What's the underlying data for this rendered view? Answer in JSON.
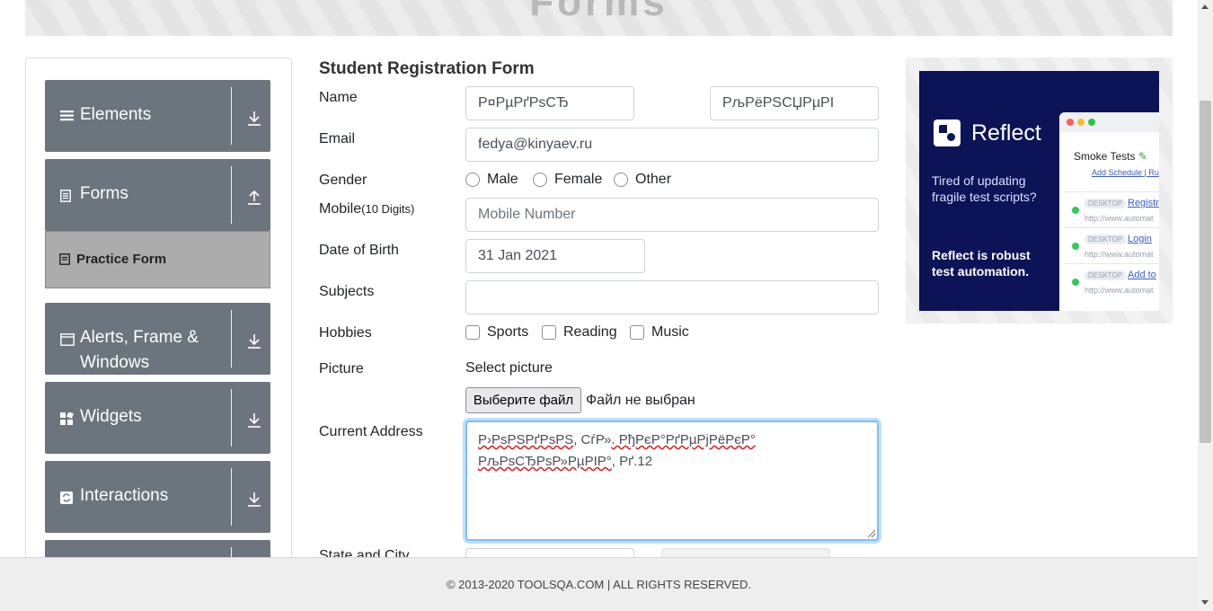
{
  "banner": {
    "title": "Forms"
  },
  "sidebar": {
    "groups": [
      {
        "label": "Elements",
        "icon": "hamburger-icon",
        "arrow": "down"
      },
      {
        "label": "Forms",
        "icon": "document-icon",
        "arrow": "up"
      },
      {
        "label": "Alerts, Frame & Windows",
        "icon": "window-icon",
        "arrow": "down"
      },
      {
        "label": "Widgets",
        "icon": "widgets-icon",
        "arrow": "down"
      },
      {
        "label": "Interactions",
        "icon": "interactions-icon",
        "arrow": "down"
      }
    ],
    "active_item": "Practice Form"
  },
  "form": {
    "title": "Student Registration Form",
    "labels": {
      "name": "Name",
      "email": "Email",
      "gender": "Gender",
      "mobile": "Mobile",
      "mobile_hint": "(10 Digits)",
      "dob": "Date of Birth",
      "subjects": "Subjects",
      "hobbies": "Hobbies",
      "picture": "Picture",
      "address": "Current Address",
      "state_city": "State and City"
    },
    "first_name": "Р¤РµРґРѕСЂ",
    "last_name": "РљРёРЅСЏРµРІ",
    "email": "fedya@kinyaev.ru",
    "gender_options": [
      "Male",
      "Female",
      "Other"
    ],
    "mobile_placeholder": "Mobile Number",
    "dob": "31 Jan 2021",
    "subjects": "",
    "hobby_options": [
      "Sports",
      "Reading",
      "Music"
    ],
    "select_picture": "Select picture",
    "file_button": "Выберите файл",
    "file_status": "Файл не выбран",
    "address_line1_a": "Р›РѕРЅРґРѕРЅ",
    "address_line1_b": ", СѓР»",
    "address_line1_c": ". РђРєР°РґРµРјРёРєР°",
    "address_line2_a": "РљРѕСЂРѕР»РµРІР°",
    "address_line2_b": ", Рґ.12"
  },
  "ad": {
    "brand": "Reflect",
    "text1": "Tired of updating fragile test scripts?",
    "text2": "Reflect is robust test automation.",
    "window_title": "Smoke Tests",
    "window_link_a": "Add Schedule",
    "window_link_b": "Ru",
    "rows": [
      {
        "tag": "DESKTOP",
        "link": "Registr",
        "url": "http://www.automat"
      },
      {
        "tag": "DESKTOP",
        "link": "Login",
        "url": "http://www.automat"
      },
      {
        "tag": "DESKTOP",
        "link": "Add to",
        "url": "http://www.automat"
      }
    ]
  },
  "footer": {
    "text": "© 2013-2020 TOOLSQA.COM | ALL RIGHTS RESERVED."
  },
  "colors": {
    "sidebar_group": "#6c757d",
    "active_item": "#acacac",
    "focus": "#80bdff",
    "ad_bg": "#0c1457"
  }
}
